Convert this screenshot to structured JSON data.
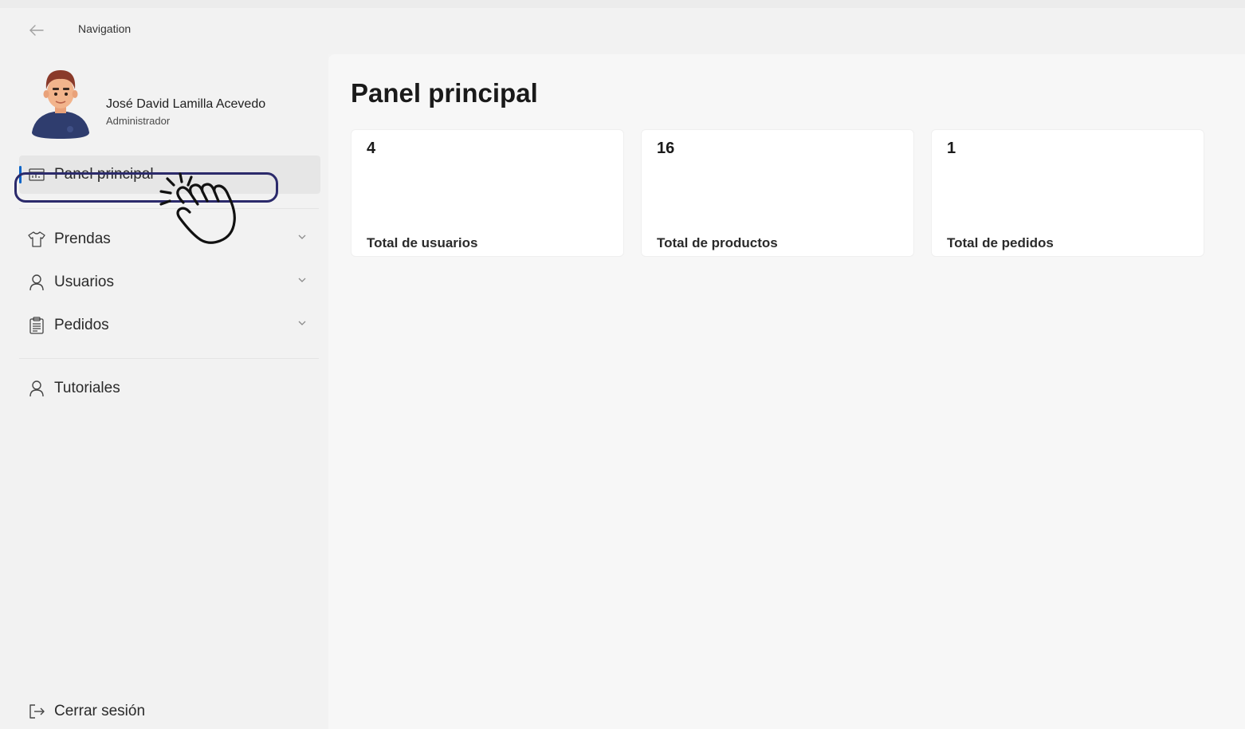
{
  "titlebar": {
    "title": "Navigation"
  },
  "profile": {
    "name": "José David Lamilla Acevedo",
    "role": "Administrador"
  },
  "sidebar": {
    "items": [
      {
        "label": "Panel principal",
        "icon": "dashboard-icon",
        "active": true
      },
      {
        "label": "Prendas",
        "icon": "shirt-icon",
        "expandable": true
      },
      {
        "label": "Usuarios",
        "icon": "person-icon",
        "expandable": true
      },
      {
        "label": "Pedidos",
        "icon": "clipboard-icon",
        "expandable": true
      },
      {
        "label": "Tutoriales",
        "icon": "person-icon"
      }
    ],
    "logout": {
      "label": "Cerrar sesión",
      "icon": "sign-out-icon"
    }
  },
  "main": {
    "title": "Panel principal",
    "cards": [
      {
        "value": "4",
        "label": "Total de usuarios"
      },
      {
        "value": "16",
        "label": "Total de productos"
      },
      {
        "value": "1",
        "label": "Total de pedidos"
      }
    ]
  },
  "colors": {
    "accent": "#0a64c8",
    "highlight": "#2b2a6b"
  }
}
